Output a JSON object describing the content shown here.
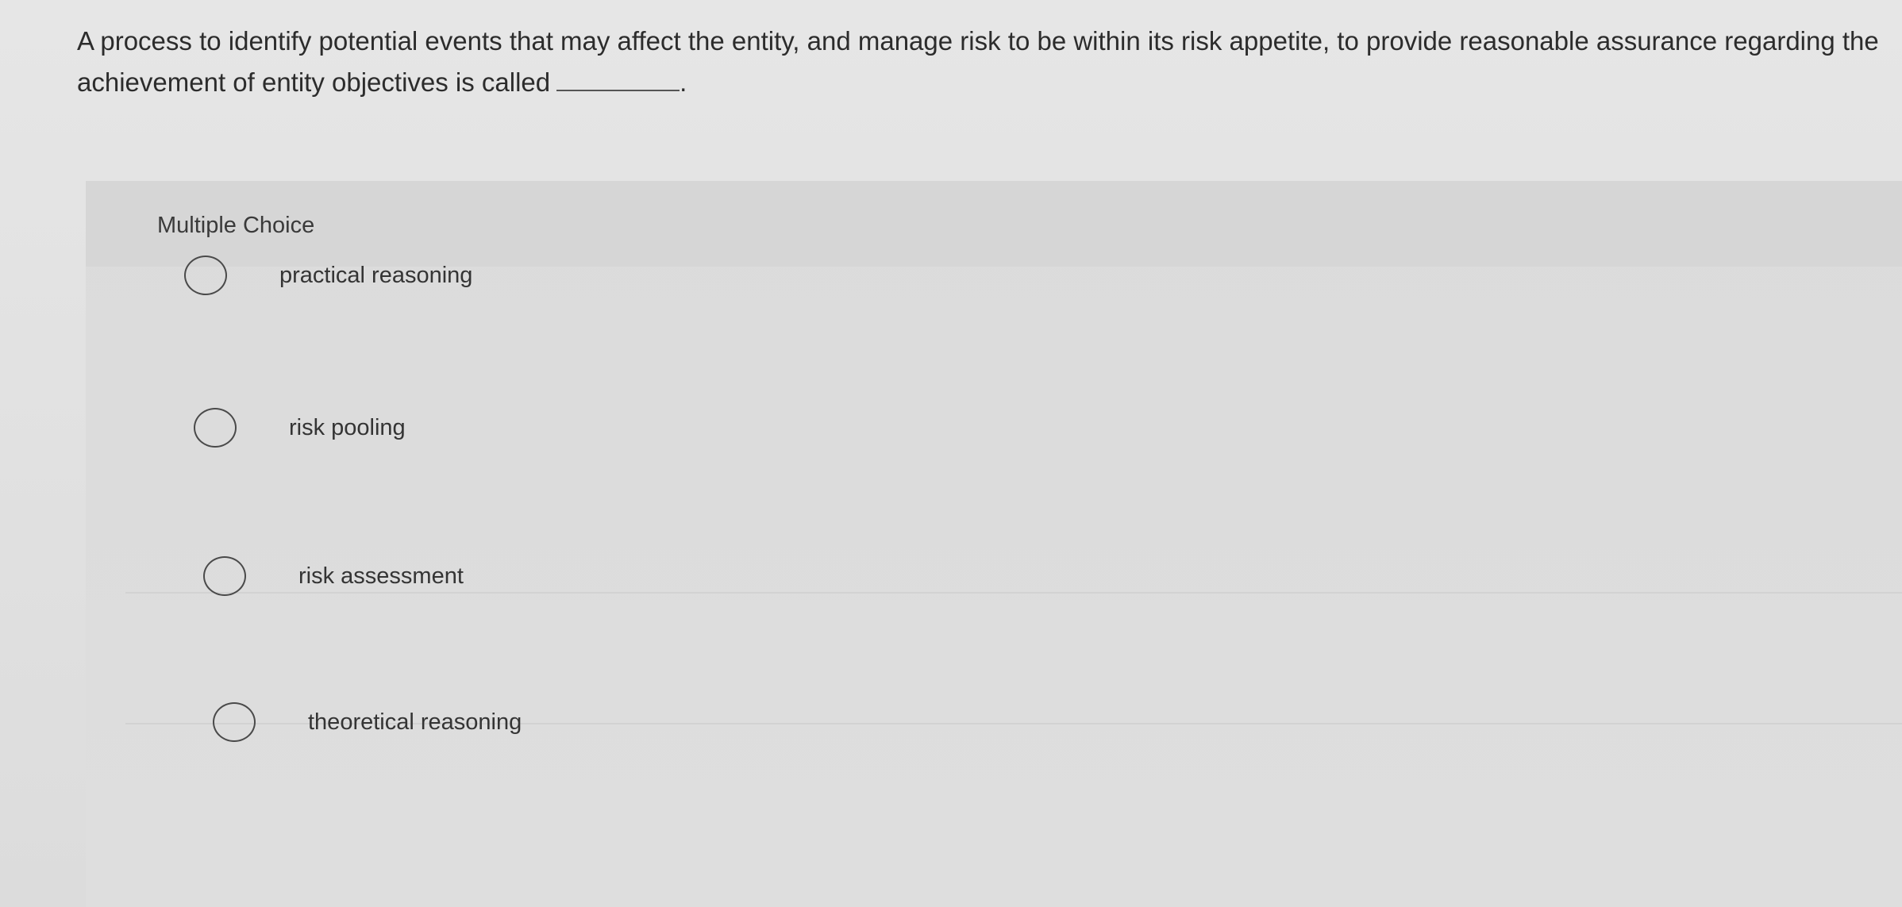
{
  "question": {
    "text": "A process to identify potential events that may affect the entity, and manage risk to be within its risk appetite, to provide reasonable assurance regarding the achievement of entity objectives is called",
    "blank_suffix": "."
  },
  "panel": {
    "type_label": "Multiple Choice"
  },
  "choices": [
    {
      "label": "practical reasoning",
      "selected": false
    },
    {
      "label": "risk pooling",
      "selected": false
    },
    {
      "label": "risk assessment",
      "selected": false
    },
    {
      "label": "theoretical reasoning",
      "selected": false
    }
  ]
}
